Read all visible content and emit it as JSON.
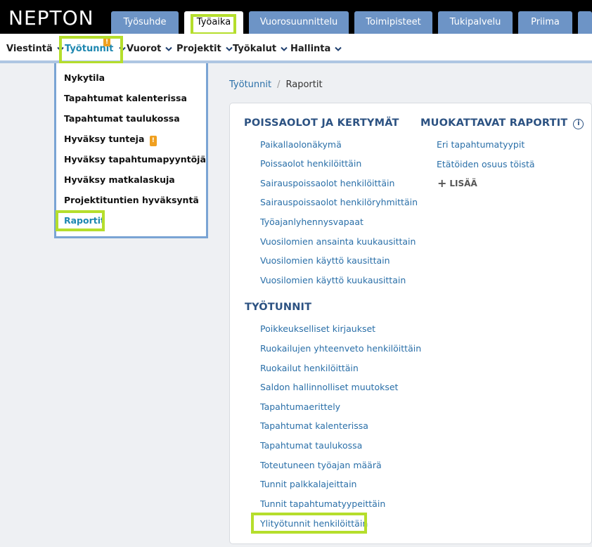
{
  "app": {
    "logo": "NEPTON"
  },
  "top_tabs": [
    {
      "label": "Työsuhde"
    },
    {
      "label": "Työaika",
      "active": true
    },
    {
      "label": "Vuorosuunnittelu"
    },
    {
      "label": "Toimipisteet"
    },
    {
      "label": "Tukipalvelu"
    },
    {
      "label": "Priima"
    }
  ],
  "nav": {
    "items": [
      {
        "label": "Viestintä"
      },
      {
        "label": "Työtunnit",
        "active": true,
        "badge": "!"
      },
      {
        "label": "Vuorot"
      },
      {
        "label": "Projektit"
      },
      {
        "label": "Työkalut"
      },
      {
        "label": "Hallinta"
      }
    ]
  },
  "dropdown": {
    "items": [
      {
        "label": "Nykytila"
      },
      {
        "label": "Tapahtumat kalenterissa"
      },
      {
        "label": "Tapahtumat taulukossa"
      },
      {
        "label": "Hyväksy tunteja",
        "badge": "!"
      },
      {
        "label": "Hyväksy tapahtumapyyntöjä"
      },
      {
        "label": "Hyväksy matkalaskuja"
      },
      {
        "label": "Projektituntien hyväksyntä"
      },
      {
        "label": "Raportit",
        "current": true
      }
    ]
  },
  "breadcrumb": {
    "parent": "Työtunnit",
    "separator": "/",
    "current": "Raportit"
  },
  "reports": {
    "absence": {
      "title": "POISSAOLOT JA KERTYMÄT",
      "links": [
        "Paikallaolonäkymä",
        "Poissaolot henkilöittäin",
        "Sairauspoissaolot henkilöittäin",
        "Sairauspoissaolot henkilöryhmittäin",
        "Työajanlyhennysvapaat",
        "Vuosilomien ansainta kuukausittain",
        "Vuosilomien käyttö kausittain",
        "Vuosilomien käyttö kuukausittain"
      ]
    },
    "custom": {
      "title": "MUOKATTAVAT RAPORTIT",
      "info_icon": "i",
      "links": [
        "Eri tapahtumatyypit",
        "Etätöiden osuus töistä"
      ],
      "add_label": "LISÄÄ",
      "add_icon": "+"
    },
    "hours": {
      "title": "TYÖTUNNIT",
      "links": [
        "Poikkeukselliset kirjaukset",
        "Ruokailujen yhteenveto henkilöittäin",
        "Ruokailut henkilöittäin",
        "Saldon hallinnolliset muutokset",
        "Tapahtumaerittely",
        "Tapahtumat kalenterissa",
        "Tapahtumat taulukossa",
        "Toteutuneen työajan määrä",
        "Tunnit palkkalajeittain",
        "Tunnit tapahtumatyypeittäin",
        "Ylityötunnit henkilöittäin"
      ]
    }
  },
  "colors": {
    "accent": "#1d87b0",
    "tab": "#6d94c6",
    "highlight": "#b5de2c",
    "badge": "#f0a020"
  }
}
